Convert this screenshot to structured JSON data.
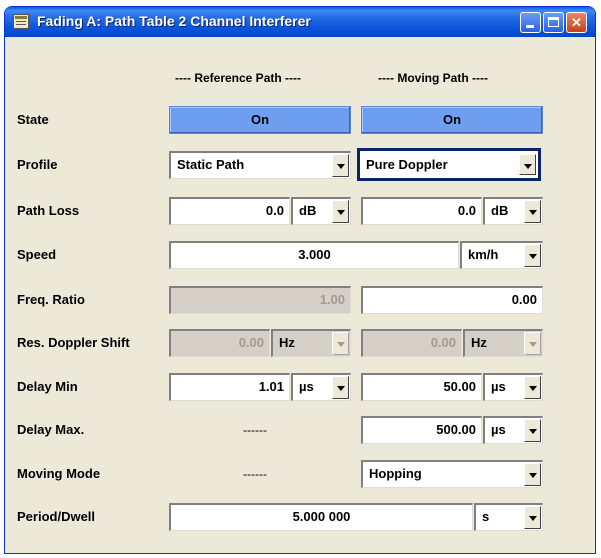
{
  "window": {
    "title": "Fading A: Path Table 2 Channel Interferer"
  },
  "columns": {
    "reference": "---- Reference Path ----",
    "moving": "---- Moving Path ----"
  },
  "rows": {
    "state": {
      "label": "State",
      "ref_value": "On",
      "mov_value": "On"
    },
    "profile": {
      "label": "Profile",
      "ref_value": "Static Path",
      "mov_value": "Pure Doppler"
    },
    "path_loss": {
      "label": "Path Loss",
      "ref_value": "0.0",
      "ref_unit": "dB",
      "mov_value": "0.0",
      "mov_unit": "dB"
    },
    "speed": {
      "label": "Speed",
      "value": "3.000",
      "unit": "km/h"
    },
    "freq_ratio": {
      "label": "Freq. Ratio",
      "ref_value": "1.00",
      "mov_value": "0.00"
    },
    "res_doppler": {
      "label": "Res. Doppler Shift",
      "ref_value": "0.00",
      "ref_unit": "Hz",
      "mov_value": "0.00",
      "mov_unit": "Hz"
    },
    "delay_min": {
      "label": "Delay Min",
      "ref_value": "1.01",
      "ref_unit": "µs",
      "mov_value": "50.00",
      "mov_unit": "µs"
    },
    "delay_max": {
      "label": "Delay Max.",
      "ref_value": "------",
      "mov_value": "500.00",
      "mov_unit": "µs"
    },
    "moving_mode": {
      "label": "Moving Mode",
      "ref_value": "------",
      "mov_value": "Hopping"
    },
    "period_dwell": {
      "label": "Period/Dwell",
      "value": "5.000 000",
      "unit": "s"
    }
  },
  "colors": {
    "window_bg": "#ece9d8",
    "state_on": "#6e9ef0",
    "title_bar": "#0a54dc",
    "focus_border": "#0a246a"
  }
}
